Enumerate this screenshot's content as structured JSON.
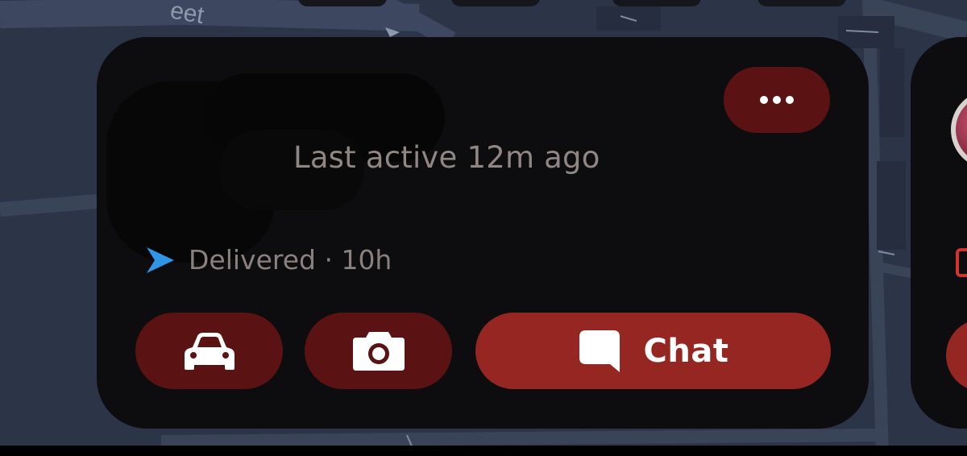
{
  "map": {
    "street_fragment": "eet"
  },
  "card": {
    "last_active": "Last active 12m ago",
    "status": "Delivered · 10h",
    "chat_label": "Chat"
  },
  "colors": {
    "card_background": "#0d0c0e",
    "button_dark_red": "#5a1212",
    "chat_button_red": "#962622",
    "delivered_arrow_blue": "#2f95e6",
    "muted_text": "#908683",
    "map_background": "#2c3448"
  },
  "icons": {
    "more": "more-dots-icon",
    "status": "delivered-arrow-icon",
    "car": "car-icon",
    "camera": "camera-icon",
    "chat": "chat-bubble-icon"
  }
}
